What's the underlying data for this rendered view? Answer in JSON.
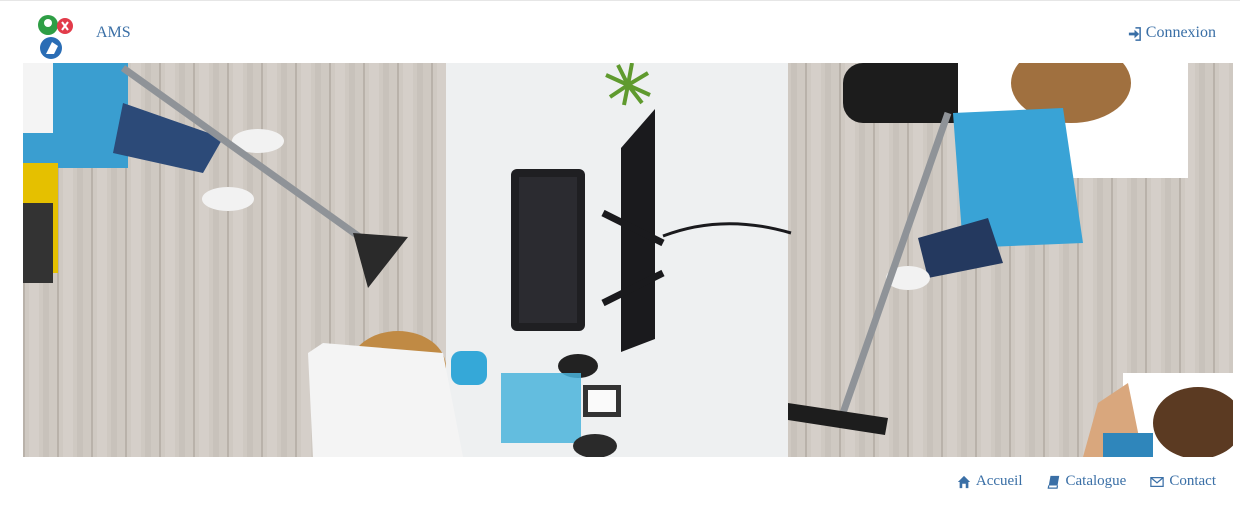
{
  "header": {
    "brand": "AMS",
    "login_label": "Connexion"
  },
  "nav": {
    "items": [
      {
        "label": "Accueil",
        "icon": "home-icon"
      },
      {
        "label": "Catalogue",
        "icon": "book-icon"
      },
      {
        "label": "Contact",
        "icon": "envelope-icon"
      }
    ]
  },
  "colors": {
    "link": "#3a6fa6",
    "logo_green": "#2e9e45",
    "logo_red": "#e23b4a",
    "logo_blue": "#2a6db5"
  }
}
